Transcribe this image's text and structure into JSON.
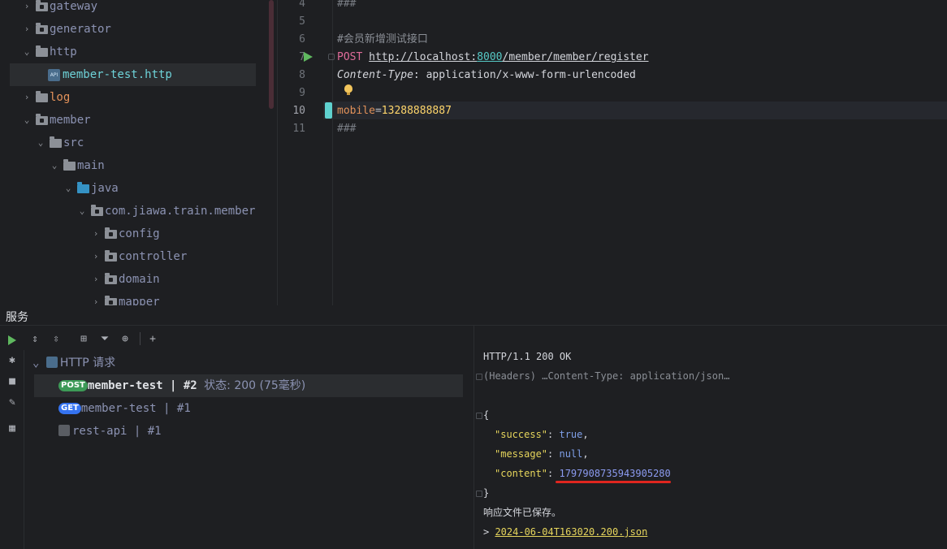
{
  "tree": {
    "items": [
      {
        "label": "gateway",
        "kind": "folder"
      },
      {
        "label": "generator",
        "kind": "folder"
      },
      {
        "label": "http",
        "kind": "folder"
      },
      {
        "label": "member-test.http",
        "kind": "file"
      },
      {
        "label": "log",
        "kind": "folder"
      },
      {
        "label": "member",
        "kind": "folder"
      },
      {
        "label": "src",
        "kind": "folder"
      },
      {
        "label": "main",
        "kind": "folder"
      },
      {
        "label": "java",
        "kind": "folder"
      },
      {
        "label": "com.jiawa.train.member",
        "kind": "package"
      },
      {
        "label": "config",
        "kind": "package"
      },
      {
        "label": "controller",
        "kind": "package"
      },
      {
        "label": "domain",
        "kind": "package"
      },
      {
        "label": "mapper",
        "kind": "package"
      }
    ]
  },
  "editor": {
    "line_numbers": [
      "4",
      "5",
      "6",
      "7",
      "8",
      "9",
      "10",
      "11"
    ],
    "sep_top": "###",
    "comment": "#会员新增测试接口",
    "method": "POST",
    "url_prefix": "http://localhost:",
    "url_port": "8000",
    "url_path": "/member/member/register",
    "header_name": "Content-Type",
    "header_colon": ":",
    "header_value": " application/x-www-form-urlencoded",
    "body_key": "mobile",
    "body_eq": "=",
    "body_value": "13288888887",
    "sep_bottom": "###"
  },
  "services": {
    "title": "服务",
    "group_label": "HTTP 请求",
    "requests": [
      {
        "method": "POST",
        "name": "member-test",
        "sep": " | ",
        "num": "#2",
        "status": "状态: 200 (75毫秒)"
      },
      {
        "method": "GET",
        "name": "member-test",
        "sep": " | ",
        "num": "#1"
      },
      {
        "name": "rest-api",
        "sep": " | ",
        "num": "#1"
      }
    ]
  },
  "response": {
    "status_line": "HTTP/1.1 200 OK",
    "headers": "(Headers) …Content-Type: application/json…",
    "open_brace": "{",
    "success_key": "\"success\"",
    "success_val": "true",
    "message_key": "\"message\"",
    "message_val": "null",
    "content_key": "\"content\"",
    "content_val": "1797908735943905280",
    "close_brace": "}",
    "saved_msg": "响应文件已保存。",
    "file_prefix": "> ",
    "file_link": "2024-06-04T163020.200.json"
  },
  "colors": {
    "accent_underline": "#e0261f",
    "post_badge": "#3d9a57",
    "get_badge": "#3573f0",
    "run_green": "#5fb85f"
  }
}
